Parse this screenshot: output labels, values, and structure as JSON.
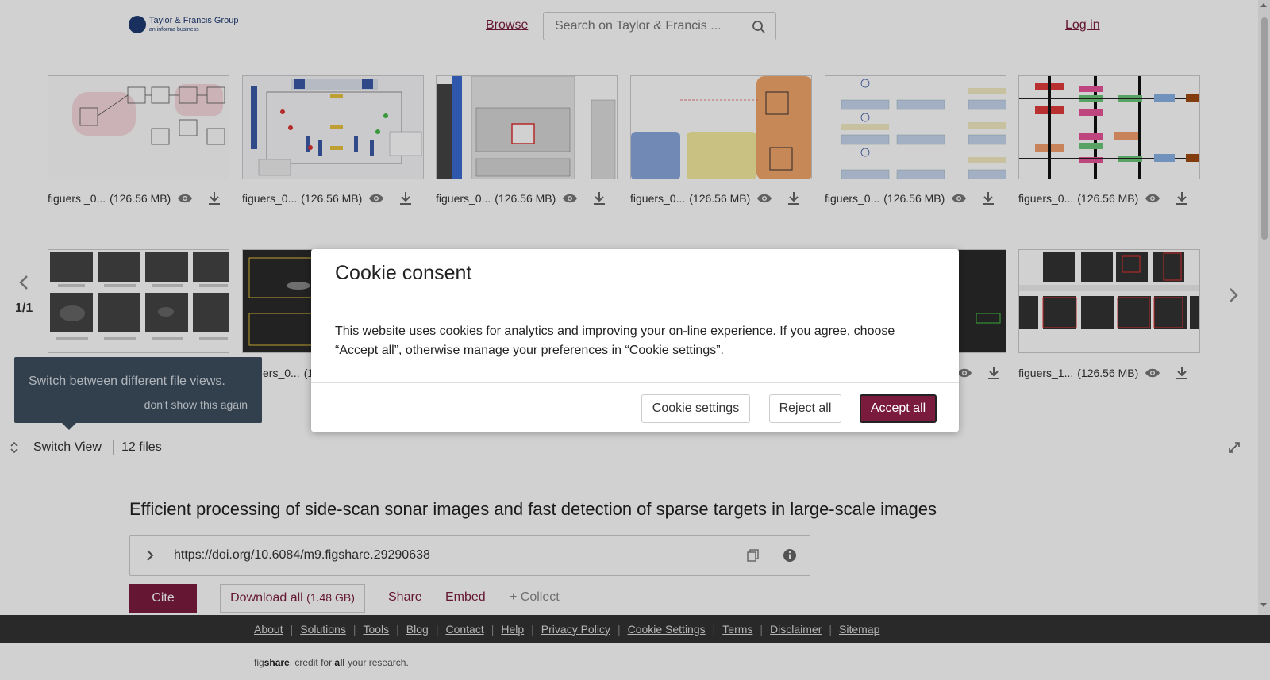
{
  "header": {
    "logo_main": "Taylor & Francis Group",
    "logo_sub": "an informa business",
    "browse_label": "Browse",
    "search_placeholder": "Search on Taylor & Francis ...",
    "login_label": "Log in"
  },
  "gallery": {
    "pager": "1/1",
    "row1": [
      {
        "name": "figuers _0...",
        "size": "(126.56 MB)"
      },
      {
        "name": "figuers_0...",
        "size": "(126.56 MB)"
      },
      {
        "name": "figuers_0...",
        "size": "(126.56 MB)"
      },
      {
        "name": "figuers_0...",
        "size": "(126.56 MB)"
      },
      {
        "name": "figuers_0...",
        "size": "(126.56 MB)"
      },
      {
        "name": "figuers_0...",
        "size": "(126.56 MB)"
      }
    ],
    "row2": [
      {
        "name": "",
        "size": ""
      },
      {
        "name": "ers_0...",
        "size": "(1"
      },
      {
        "name": "figuers_1...",
        "size": "(126.56 MB)"
      }
    ],
    "tooltip_message": "Switch between different file views.",
    "tooltip_dismiss": "don't show this again",
    "switch_view_label": "Switch View",
    "file_count": "12 files"
  },
  "item": {
    "title": "Efficient processing of side-scan sonar images and fast detection of sparse targets in large-scale images",
    "doi": "https://doi.org/10.6084/m9.figshare.29290638",
    "cite_label": "Cite",
    "download_label": "Download all",
    "download_size": "(1.48 GB)",
    "share_label": "Share",
    "embed_label": "Embed",
    "collect_label": "+ Collect"
  },
  "footer": {
    "links": [
      "About",
      "Solutions",
      "Tools",
      "Blog",
      "Contact",
      "Help",
      "Privacy Policy",
      "Cookie Settings",
      "Terms",
      "Disclaimer",
      "Sitemap"
    ],
    "tag_fig": "fig",
    "tag_share": "share",
    "tag_mid": ". credit for ",
    "tag_all": "all",
    "tag_end": " your research."
  },
  "cookie": {
    "title": "Cookie consent",
    "body": "This website uses cookies for analytics and improving your on-line experience. If you agree, choose “Accept all”, otherwise manage your preferences in “Cookie settings”.",
    "settings_label": "Cookie settings",
    "reject_label": "Reject all",
    "accept_label": "Accept all"
  },
  "colors": {
    "brand": "#7a1b3d",
    "footer_bg": "#333333",
    "tooltip_bg": "#3d4e5e"
  }
}
